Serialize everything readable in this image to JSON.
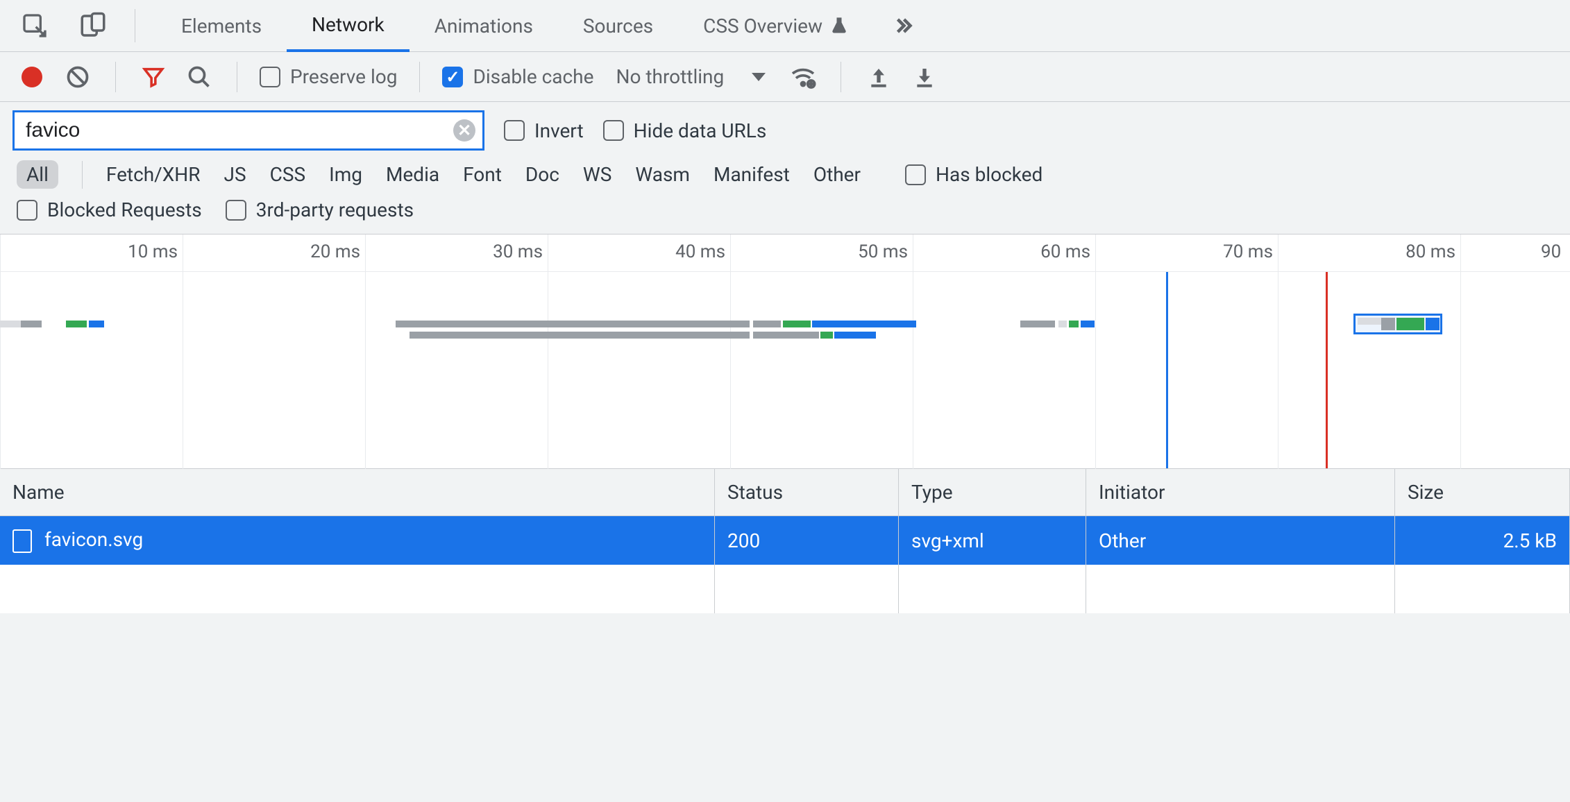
{
  "tabs": {
    "items": [
      "Elements",
      "Network",
      "Animations",
      "Sources",
      "CSS Overview"
    ],
    "active_index": 1
  },
  "toolbar": {
    "preserve_log_label": "Preserve log",
    "preserve_log_checked": false,
    "disable_cache_label": "Disable cache",
    "disable_cache_checked": true,
    "throttling_label": "No throttling"
  },
  "filter": {
    "value": "favico",
    "invert_label": "Invert",
    "invert_checked": false,
    "hide_data_urls_label": "Hide data URLs",
    "hide_data_urls_checked": false
  },
  "type_filters": {
    "items": [
      "All",
      "Fetch/XHR",
      "JS",
      "CSS",
      "Img",
      "Media",
      "Font",
      "Doc",
      "WS",
      "Wasm",
      "Manifest",
      "Other"
    ],
    "active_index": 0,
    "has_blocked_label": "Has blocked",
    "has_blocked_checked": false,
    "blocked_requests_label": "Blocked Requests",
    "blocked_requests_checked": false,
    "third_party_label": "3rd-party requests",
    "third_party_checked": false
  },
  "timeline": {
    "ticks": [
      "10 ms",
      "20 ms",
      "30 ms",
      "40 ms",
      "50 ms",
      "60 ms",
      "70 ms",
      "80 ms",
      "90 "
    ]
  },
  "table": {
    "headers": [
      "Name",
      "Status",
      "Type",
      "Initiator",
      "Size"
    ],
    "rows": [
      {
        "name": "favicon.svg",
        "status": "200",
        "type": "svg+xml",
        "initiator": "Other",
        "size": "2.5 kB",
        "selected": true
      }
    ]
  }
}
